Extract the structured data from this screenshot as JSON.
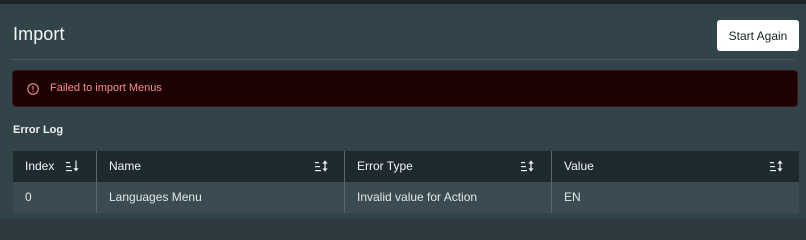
{
  "header": {
    "title": "Import",
    "start_again_label": "Start Again"
  },
  "alert": {
    "message": "Failed to import Menus",
    "icon": "alert-circle-icon",
    "color": "#f38f8f"
  },
  "error_log": {
    "label": "Error Log",
    "columns": [
      {
        "label": "Index",
        "icon": "sort-icon"
      },
      {
        "label": "Name",
        "icon": "sort-icon"
      },
      {
        "label": "Error Type",
        "icon": "sort-icon"
      },
      {
        "label": "Value",
        "icon": "sort-icon"
      }
    ],
    "rows": [
      [
        "0",
        "Languages Menu",
        "Invalid value for Action",
        "EN"
      ]
    ]
  },
  "colors": {
    "background": "#33434a",
    "alert_background": "#1d0303",
    "table_header": "#1f2a2e",
    "table_row": "#3b4b52"
  }
}
